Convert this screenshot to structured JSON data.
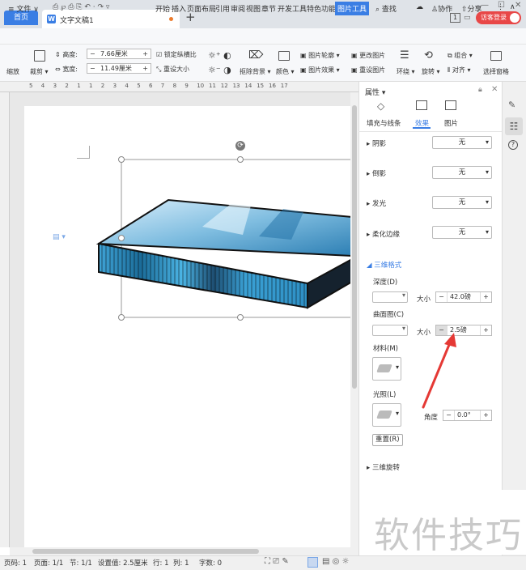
{
  "titlebar": {
    "home_tab": "首页",
    "doc_tab": "文字文稿1",
    "badge": "1",
    "login": "访客登录"
  },
  "menu": {
    "file": "文件",
    "items": [
      "开始",
      "插入",
      "页面布局",
      "引用",
      "审阅",
      "视图",
      "章节",
      "开发工具",
      "特色功能",
      "图片工具"
    ],
    "search": "查找",
    "collab": "协作",
    "share": "分享"
  },
  "toolbar": {
    "zoom_label": "缩放",
    "crop_label": "裁剪",
    "height_label": "高度:",
    "height_value": "7.66厘米",
    "width_label": "宽度:",
    "width_value": "11.49厘米",
    "lock_ratio": "锁定纵横比",
    "reset_size": "重设大小",
    "remove_bg": "抠除背景",
    "color": "颜色",
    "outline": "图片轮廓",
    "effect": "图片效果",
    "change_pic": "更改图片",
    "reset_pic": "重设图片",
    "wrap": "环绕",
    "rotate": "旋转",
    "group": "组合",
    "align": "对齐",
    "selection_pane": "选择窗格"
  },
  "ruler": {
    "labels": [
      "5",
      "4",
      "3",
      "2",
      "1",
      "1",
      "2",
      "3",
      "4",
      "5",
      "6",
      "7",
      "8",
      "9",
      "10",
      "11",
      "12",
      "13",
      "14",
      "15",
      "16",
      "17"
    ]
  },
  "panel": {
    "title": "属性",
    "tabs": [
      "填充与线条",
      "效果",
      "图片"
    ],
    "active_tab": "效果",
    "sections": [
      {
        "label": "阴影",
        "value": "无"
      },
      {
        "label": "倒影",
        "value": "无"
      },
      {
        "label": "发光",
        "value": "无"
      },
      {
        "label": "柔化边缘",
        "value": "无"
      }
    ],
    "three_d_format": "三维格式",
    "depth_label": "深度(D)",
    "depth_size_label": "大小",
    "depth_value": "42.0磅",
    "contour_label": "曲面图(C)",
    "contour_size_label": "大小",
    "contour_value": "2.5磅",
    "material_label": "材料(M)",
    "lighting_label": "光照(L)",
    "angle_label": "角度",
    "angle_value": "0.0°",
    "reset_button": "重置(R)",
    "three_d_rotation": "三维旋转"
  },
  "status": {
    "page_no": "页码: 1",
    "pages": "页面: 1/1",
    "section": "节: 1/1",
    "setting": "设置值: 2.5厘米",
    "row": "行: 1",
    "col": "列: 1",
    "words": "字数: 0"
  },
  "watermark": "软件技巧",
  "colors": {
    "accent": "#3a7ee4",
    "login": "#e84747",
    "arrow": "#e53935"
  }
}
